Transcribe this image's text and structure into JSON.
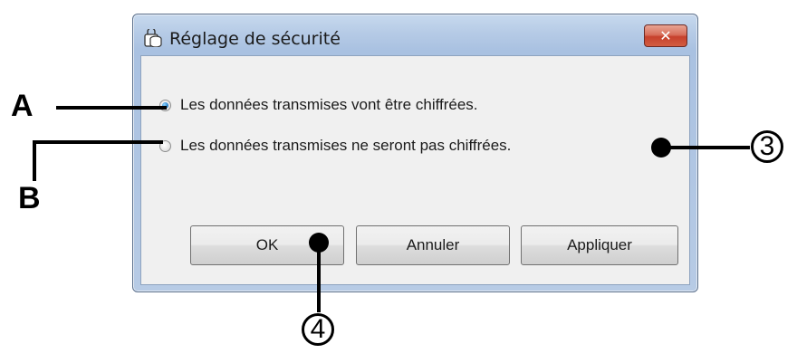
{
  "dialog": {
    "title": "Réglage de sécurité",
    "close_label": "✕",
    "options": [
      {
        "label": "Les données transmises vont être chiffrées.",
        "checked": true
      },
      {
        "label": "Les données transmises ne seront pas chiffrées.",
        "checked": false
      }
    ],
    "buttons": {
      "ok": "OK",
      "cancel": "Annuler",
      "apply": "Appliquer"
    }
  },
  "annotations": {
    "label_a": "A",
    "label_b": "B",
    "callout_3": "3",
    "callout_4": "4"
  },
  "icons": {
    "title_icon": "security-settings-icon",
    "close_icon": "close-icon"
  },
  "colors": {
    "title_gradient_top": "#c7d9ee",
    "close_button": "#c7412c",
    "radio_selected": "#2f8ad1",
    "client_bg": "#f0f0f0"
  }
}
